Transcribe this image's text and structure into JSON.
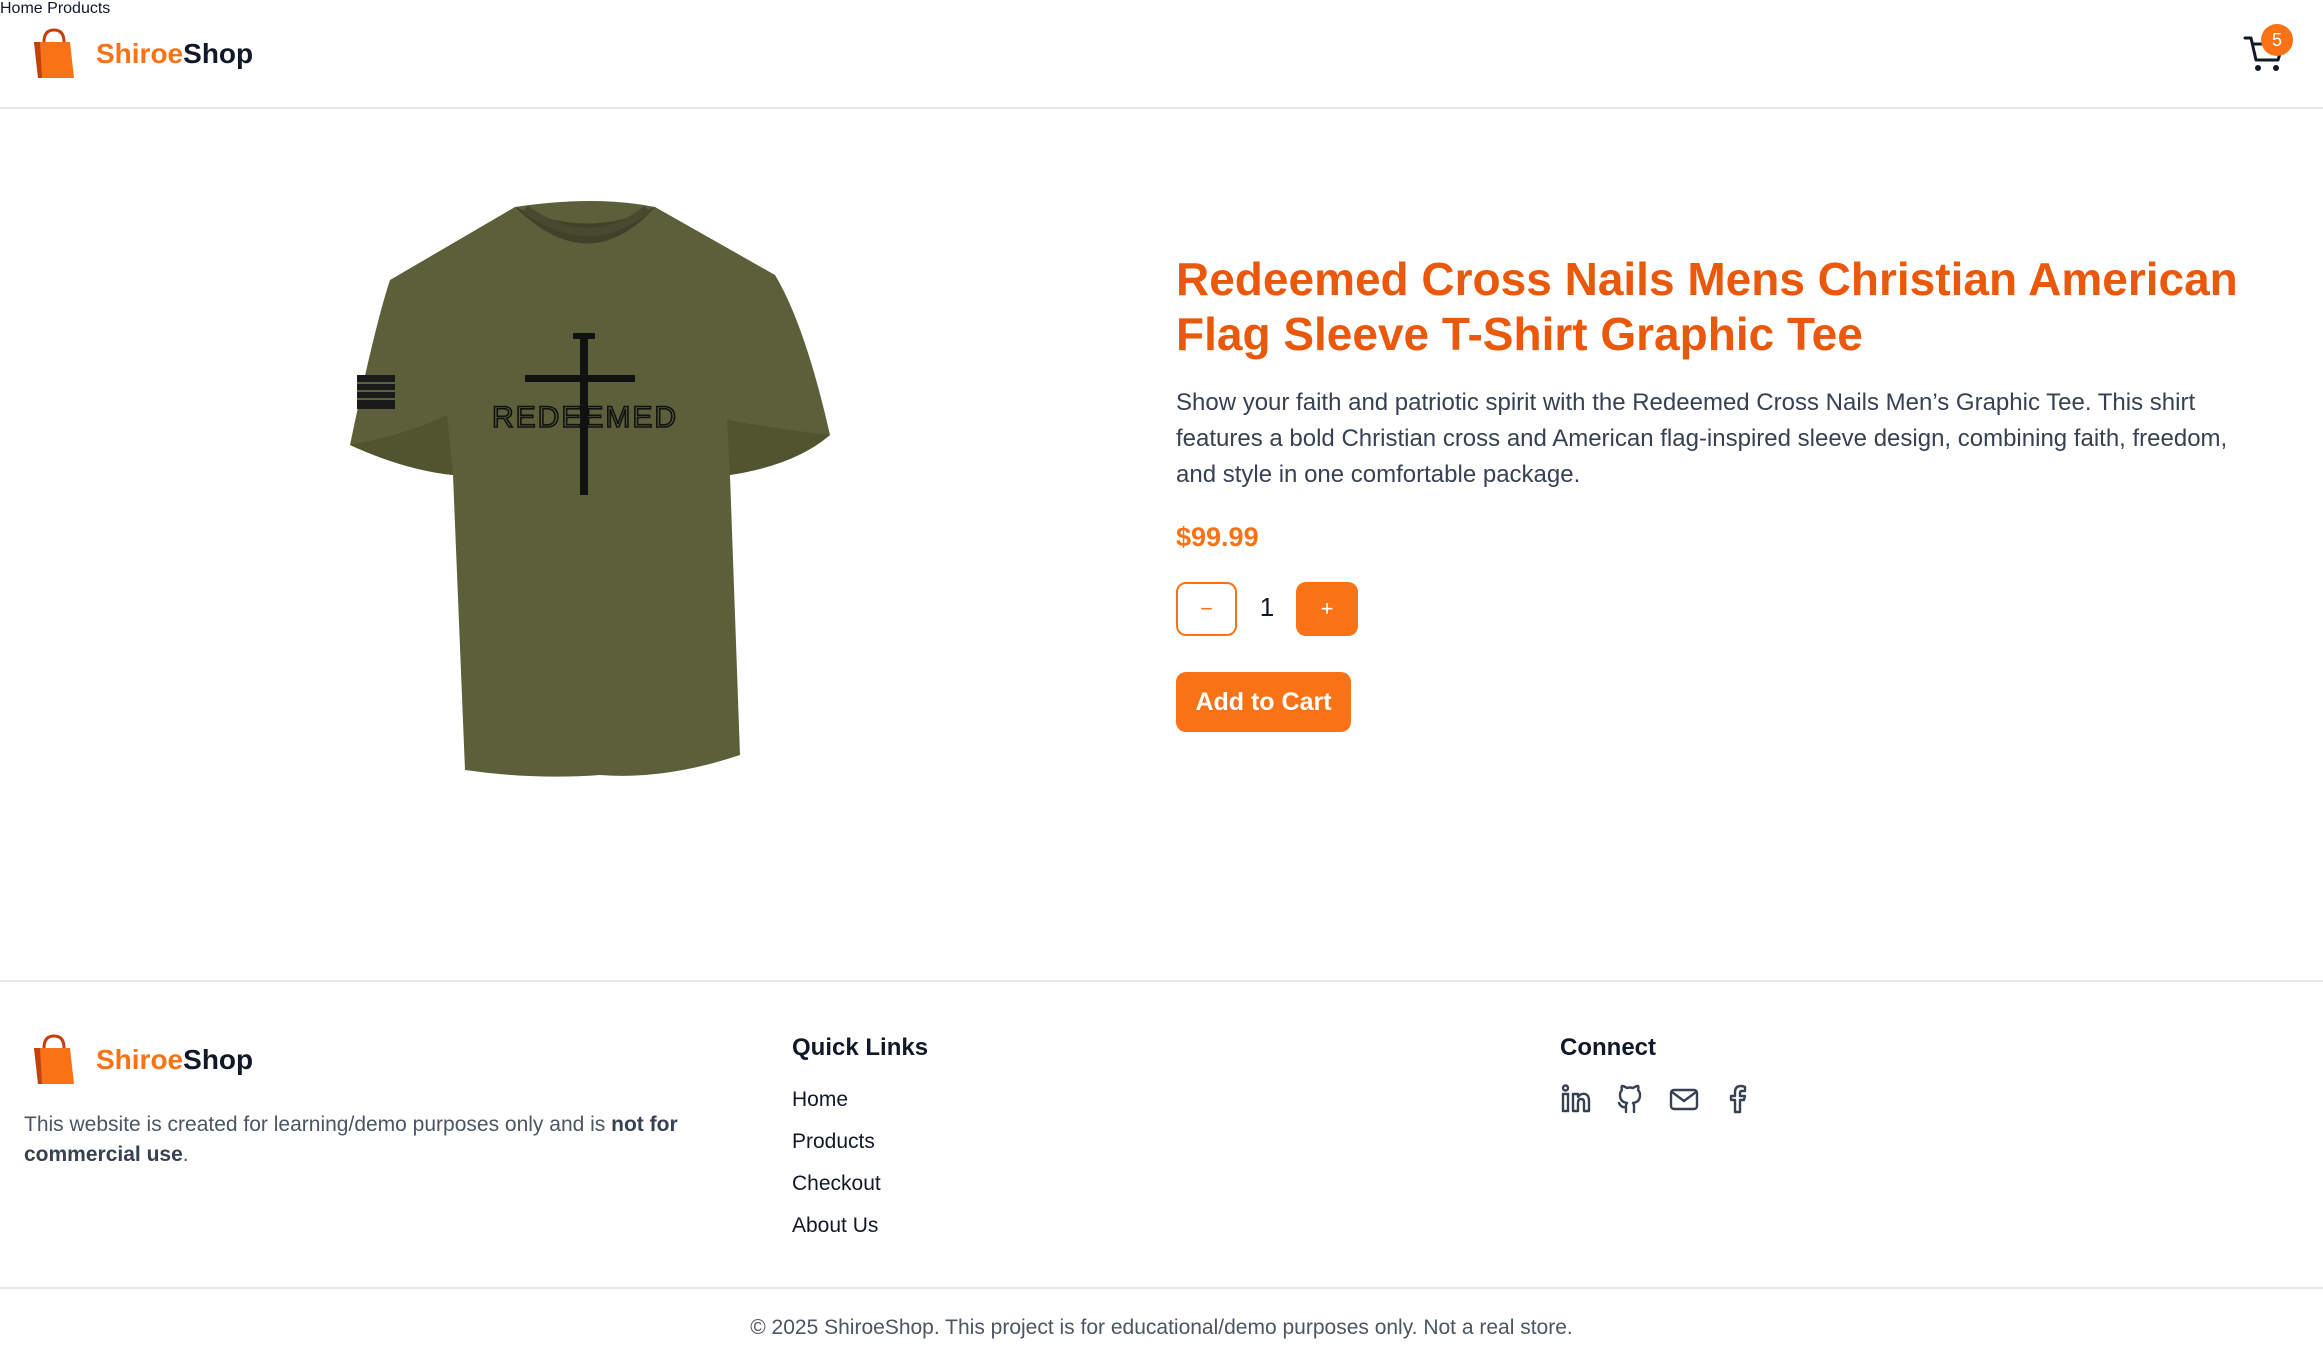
{
  "brand": {
    "name_part1": "Shiroe",
    "name_part2": "Shop"
  },
  "nav": {
    "home": "Home",
    "products": "Products",
    "cart_count": "5"
  },
  "product": {
    "title": "Redeemed Cross Nails Mens Christian American Flag Sleeve T-Shirt Graphic Tee",
    "description": "Show your faith and patriotic spirit with the Redeemed Cross Nails Men’s Graphic Tee. This shirt features a bold Christian cross and American flag-inspired sleeve design, combining faith, freedom, and style in one comfortable package.",
    "price": "$99.99",
    "quantity": "1",
    "minus_label": "−",
    "plus_label": "+",
    "add_to_cart": "Add to Cart",
    "shirt_text": "REDEEMED",
    "shirt_color": "#5b5f3a"
  },
  "footer": {
    "note_prefix": "This website is created for learning/demo purposes only and is ",
    "note_bold": "not for commercial use",
    "note_suffix": ".",
    "quick_links_title": "Quick Links",
    "quick_links": [
      "Home",
      "Products",
      "Checkout",
      "About Us"
    ],
    "connect_title": "Connect",
    "social": [
      "linkedin-icon",
      "github-icon",
      "mail-icon",
      "facebook-icon"
    ],
    "copyright": "© 2025 ShiroeShop. This project is for educational/demo purposes only. Not a real store."
  },
  "colors": {
    "accent": "#f97316",
    "title": "#ea580c"
  }
}
